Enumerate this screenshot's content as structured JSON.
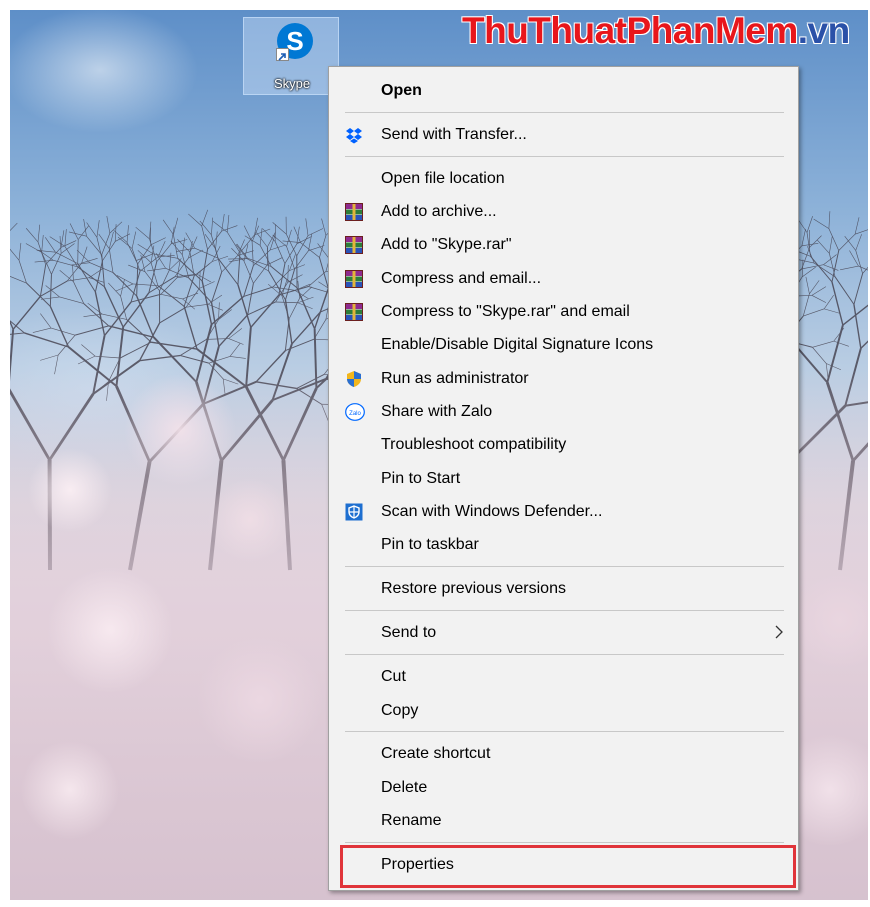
{
  "desktop": {
    "icon": {
      "label": "Skype",
      "logo_letter": "S",
      "icon_name": "skype-icon"
    }
  },
  "watermark": {
    "part1": "ThuThuat",
    "part2": "PhanMem",
    "part3": ".vn",
    "red": "#e8161b",
    "blue": "#2a51a8"
  },
  "context_menu": {
    "open": "Open",
    "send_with_transfer": "Send with Transfer...",
    "open_file_location": "Open file location",
    "add_to_archive": "Add to archive...",
    "add_to_skype_rar": "Add to \"Skype.rar\"",
    "compress_and_email": "Compress and email...",
    "compress_to_skype_rar_and_email": "Compress to \"Skype.rar\" and email",
    "enable_disable_signature_icons": "Enable/Disable Digital Signature Icons",
    "run_as_administrator": "Run as administrator",
    "share_with_zalo": "Share with Zalo",
    "troubleshoot_compatibility": "Troubleshoot compatibility",
    "pin_to_start": "Pin to Start",
    "scan_with_windows_defender": "Scan with Windows Defender...",
    "pin_to_taskbar": "Pin to taskbar",
    "restore_previous_versions": "Restore previous versions",
    "send_to": "Send to",
    "cut": "Cut",
    "copy": "Copy",
    "create_shortcut": "Create shortcut",
    "delete": "Delete",
    "rename": "Rename",
    "properties": "Properties",
    "zalo_icon_text": "Zalo",
    "highlight_color": "#e0343a"
  }
}
